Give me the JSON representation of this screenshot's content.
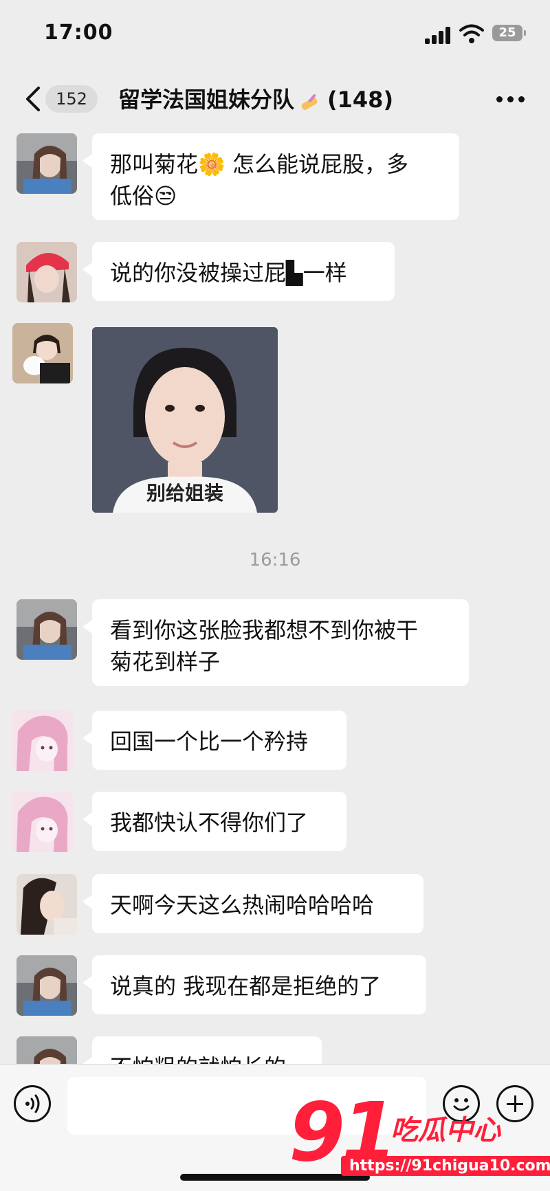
{
  "status_bar": {
    "time": "17:00",
    "battery": "25"
  },
  "nav": {
    "unread_count": "152",
    "title": "留学法国姐妹分队",
    "member_count": "(148)"
  },
  "messages": [
    {
      "text_line1": "那叫菊花🌼 怎么能说屁",
      "text_line2": "股，多",
      "text_line3": "低俗😒"
    },
    {
      "text": "说的你没被操过屁▙一样"
    },
    {
      "photo_caption": "别给姐装"
    },
    {
      "timestamp": "16:16"
    },
    {
      "text_line1": "看到你这张脸我都想不到你被干",
      "text_line2": "菊花到样子"
    },
    {
      "text": "回国一个比一个矜持"
    },
    {
      "text": "我都快认不得你们了"
    },
    {
      "text": "天啊今天这么热闹哈哈哈哈"
    },
    {
      "text": "说真的 我现在都是拒绝的了"
    },
    {
      "text": "不怕粗的就怕长的"
    }
  ],
  "input": {
    "placeholder": ""
  },
  "watermark": {
    "logo": "91",
    "name": "吃瓜中心",
    "url": "https://91chigua10.com"
  },
  "colors": {
    "bubble": "#ffffff",
    "background": "#ededed",
    "watermark": "#ff1f3a"
  }
}
